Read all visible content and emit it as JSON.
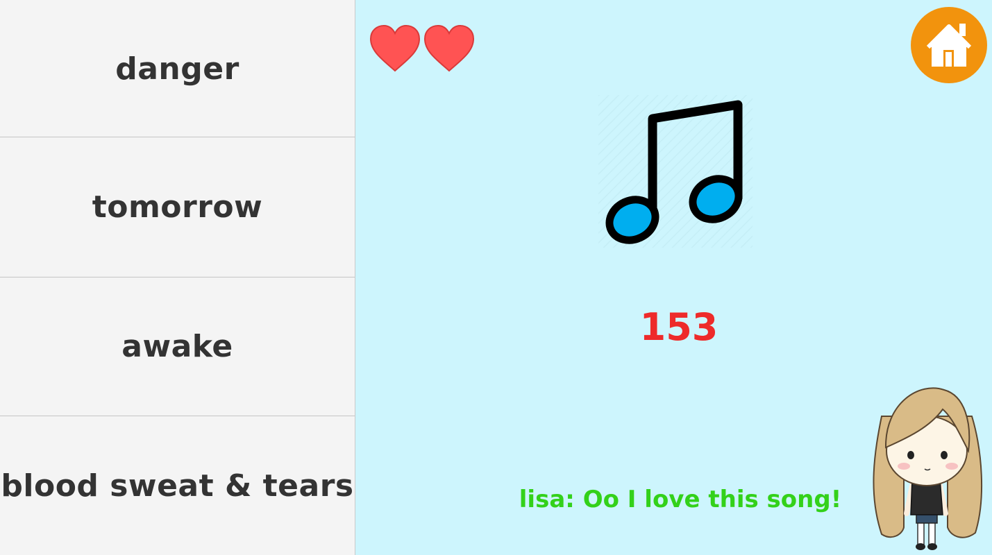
{
  "answers": [
    "danger",
    "tomorrow",
    "awake",
    "blood sweat & tears"
  ],
  "lives": 2,
  "score": "153",
  "dialogue": "lisa: Oo I love this song!",
  "colors": {
    "heart": "#ff5353",
    "home_button": "#f2930d",
    "score": "#ee2a2a",
    "dialogue": "#33d11a",
    "note_fill": "#00aeef",
    "background": "#cdf5fd"
  },
  "icons": {
    "lives": "heart-icon",
    "home": "home-icon",
    "prompt": "music-note-icon",
    "character": "chibi-girl-avatar"
  }
}
